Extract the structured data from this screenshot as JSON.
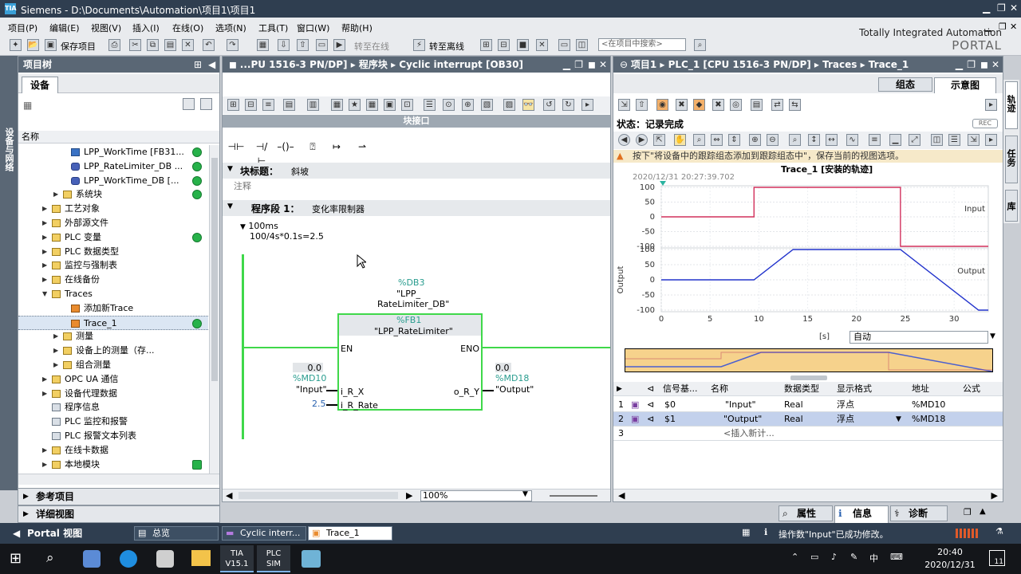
{
  "window": {
    "app": "TIA Portal",
    "title": "Siemens  -  D:\\Documents\\Automation\\项目1\\项目1"
  },
  "menu": [
    "项目(P)",
    "编辑(E)",
    "视图(V)",
    "插入(I)",
    "在线(O)",
    "选项(N)",
    "工具(T)",
    "窗口(W)",
    "帮助(H)"
  ],
  "toolbar": {
    "save_label": "保存项目",
    "go_online": "转至在线",
    "go_offline": "转至离线",
    "search_placeholder": "<在项目中搜索>"
  },
  "brand": {
    "line1": "Totally Integrated Automation",
    "line2": "PORTAL"
  },
  "left_side_tab": "设备与网络",
  "project_tree": {
    "title": "项目树",
    "tab": "设备",
    "column": "名称",
    "rows": [
      {
        "label": "LPP_WorkTime [FB31...",
        "status": true
      },
      {
        "label": "LPP_RateLimiter_DB ...",
        "status": true
      },
      {
        "label": "LPP_WorkTime_DB [...",
        "status": true
      },
      {
        "label": "系统块",
        "status": true
      },
      {
        "label": "工艺对象",
        "status": false
      },
      {
        "label": "外部源文件",
        "status": false
      },
      {
        "label": "PLC 变量",
        "status": true
      },
      {
        "label": "PLC 数据类型",
        "status": false
      },
      {
        "label": "监控与强制表",
        "status": false
      },
      {
        "label": "在线备份",
        "status": false
      },
      {
        "label": "Traces",
        "status": false
      },
      {
        "label": "添加新Trace",
        "status": false
      },
      {
        "label": "Trace_1",
        "status": true
      },
      {
        "label": "测量",
        "status": false
      },
      {
        "label": "设备上的测量（存...",
        "status": false
      },
      {
        "label": "组合测量",
        "status": false
      },
      {
        "label": "OPC UA 通信",
        "status": false
      },
      {
        "label": "设备代理数据",
        "status": false
      },
      {
        "label": "程序信息",
        "status": false
      },
      {
        "label": "PLC 监控和报警",
        "status": false
      },
      {
        "label": "PLC 报警文本列表",
        "status": false
      },
      {
        "label": "在线卡数据",
        "status": false
      },
      {
        "label": "本地模块",
        "status": true
      }
    ],
    "ref_project": "参考项目",
    "detail_view": "详细视图"
  },
  "editor": {
    "breadcrumb": "...PU 1516-3 PN/DP]  ▸  程序块  ▸  Cyclic interrupt [OB30]",
    "interface_label": "块接口",
    "block_title_label": "块标题：",
    "block_title_value": "斜坡",
    "comment": "注释",
    "network_label": "程序段 1：",
    "network_title": "变化率限制器",
    "note_line1": "100ms",
    "note_line2": "100/4s*0.1s=2.5",
    "instance_addr": "%DB3",
    "instance_name1": "\"LPP_",
    "instance_name2": "RateLimiter_DB\"",
    "fb_addr": "%FB1",
    "fb_name": "\"LPP_RateLimiter\"",
    "pin_en": "EN",
    "pin_eno": "ENO",
    "pin_in": "i_R_X",
    "pin_rate": "i_R_Rate",
    "pin_out": "o_R_Y",
    "in_value": "0.0",
    "in_addr": "%MD10",
    "in_name": "\"Input\"",
    "rate_value": "2.5",
    "out_value": "0.0",
    "out_addr": "%MD18",
    "out_name": "\"Output\"",
    "zoom": "100%"
  },
  "trace": {
    "breadcrumb": "项目1  ▸  PLC_1 [CPU 1516-3 PN/DP]  ▸  Traces  ▸  Trace_1",
    "tab_config": "组态",
    "tab_diagram": "示意图",
    "status": "状态：记录完成",
    "rec": "REC",
    "hint": "按下\"将设备中的跟踪组态添加到跟踪组态中\"，保存当前的视图选项。",
    "timestamp": "2020/12/31 20:27:39.702",
    "chart_title": "Trace_1 [安装的轨迹]",
    "x_unit": "[s]",
    "scale_mode": "自动",
    "columns": [
      "信号基...",
      "名称",
      "数据类型",
      "显示格式",
      "地址",
      "公式"
    ],
    "signals": [
      {
        "idx": "1",
        "sig": "$0",
        "name": "\"Input\"",
        "type": "Real",
        "fmt": "浮点",
        "addr": "%MD10"
      },
      {
        "idx": "2",
        "sig": "$1",
        "name": "\"Output\"",
        "type": "Real",
        "fmt": "浮点",
        "addr": "%MD18"
      }
    ],
    "insert_row": {
      "idx": "3",
      "label": "<插入新计..."
    }
  },
  "right_tabs": [
    "轨迹",
    "任务",
    "库"
  ],
  "inspector_tabs": [
    "属性",
    "信息",
    "诊断"
  ],
  "status_bar": {
    "portal_view": "Portal 视图",
    "overview": "总览",
    "tab1": "Cyclic interr...",
    "tab2": "Trace_1",
    "message": "操作数\"Input\"已成功修改。"
  },
  "taskbar": {
    "time": "20:40",
    "date": "2020/12/31",
    "ime": "中",
    "notif": "11"
  },
  "chart_data": [
    {
      "type": "line",
      "series": [
        {
          "name": "Input",
          "color": "#d2305c",
          "x": [
            0,
            9.5,
            9.5,
            24.5,
            24.5,
            33.5
          ],
          "values": [
            0,
            0,
            100,
            100,
            -100,
            -100
          ]
        }
      ],
      "xlim": [
        0,
        33.5
      ],
      "ylim": [
        -100,
        100
      ],
      "yticks": [
        100,
        50,
        0,
        -50,
        -100
      ]
    },
    {
      "type": "line",
      "series": [
        {
          "name": "Output",
          "color": "#2233cc",
          "x": [
            0,
            9.5,
            13.5,
            24.5,
            32.5,
            33.5
          ],
          "values": [
            0,
            0,
            100,
            100,
            -100,
            -100
          ]
        }
      ],
      "xlim": [
        0,
        33.5
      ],
      "ylim": [
        -100,
        100
      ],
      "yticks": [
        100,
        50,
        0,
        -50,
        -100
      ],
      "xticks": [
        0,
        5,
        10,
        15,
        20,
        25,
        30
      ],
      "ylabel": "Output"
    }
  ]
}
